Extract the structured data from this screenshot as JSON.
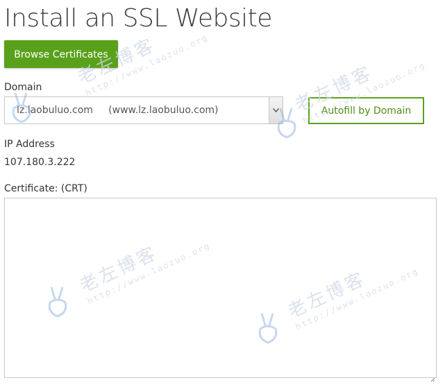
{
  "page": {
    "title": "Install an SSL Website"
  },
  "toolbar": {
    "browse_label": "Browse Certificates"
  },
  "domain": {
    "label": "Domain",
    "selected": "lz.laobuluo.com     (www.lz.laobuluo.com)",
    "autofill_label": "Autofill by Domain"
  },
  "ip": {
    "label": "IP Address",
    "value": "107.180.3.222"
  },
  "certificate": {
    "label": "Certificate: (CRT)",
    "value": ""
  },
  "watermark": {
    "text": "老左博客",
    "url": "http://www.laozuo.org"
  },
  "colors": {
    "accent": "#5aa11b",
    "border": "#c7c7c7",
    "watermark": "#cfd8e6"
  },
  "icons": {
    "select_arrow": "chevron-down-icon",
    "resize": "resize-grip-icon",
    "watermark_logo": "peace-hand-logo"
  }
}
